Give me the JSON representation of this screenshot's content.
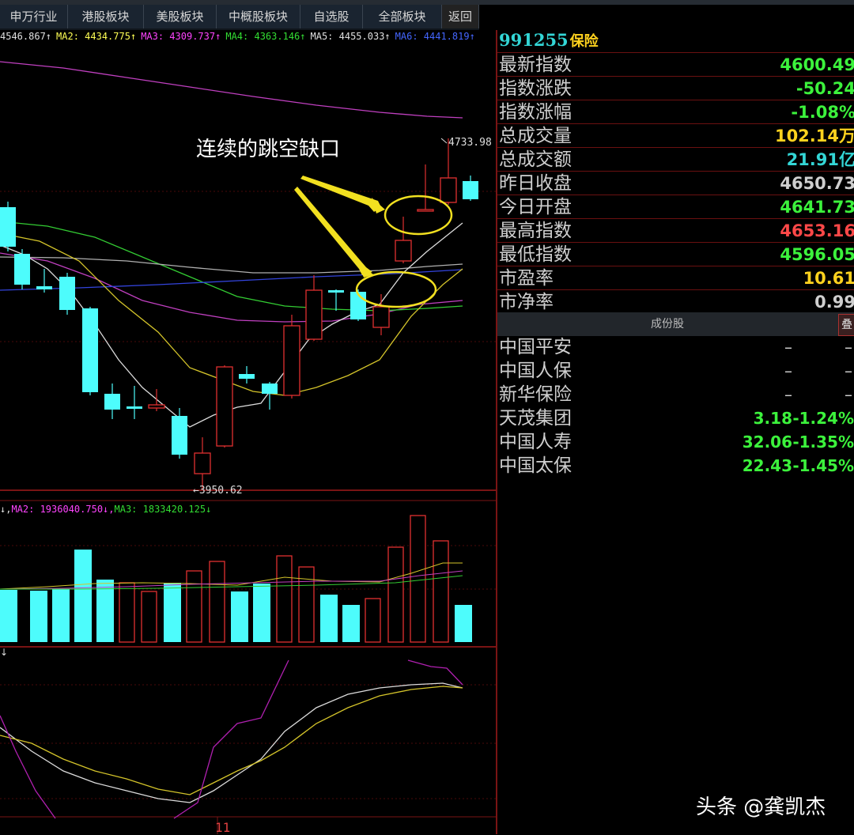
{
  "tabs": [
    "申万行业",
    "港股板块",
    "美股板块",
    "中概股板块",
    "自选股",
    "全部板块",
    "返回"
  ],
  "ma_price": [
    {
      "text": "4546.867↑",
      "color": "#e0e0e0"
    },
    {
      "text": "MA2: 4434.775↑",
      "color": "#ffff55"
    },
    {
      "text": "MA3: 4309.737↑",
      "color": "#ff44ff"
    },
    {
      "text": "MA4: 4363.146↑",
      "color": "#33dd33"
    },
    {
      "text": "MA5: 4455.033↑",
      "color": "#e0e0e0"
    },
    {
      "text": "MA6: 4441.819↑",
      "color": "#4466ff"
    }
  ],
  "annotation": "连续的跳空缺口",
  "high_label": "4733.98",
  "low_label": "←3950.62",
  "ma_volume": [
    {
      "text": "↓,",
      "color": "#e0e0e0"
    },
    {
      "text": "MA2: 1936040.750↓,",
      "color": "#ff44ff"
    },
    {
      "text": "MA3: 1833420.125↓",
      "color": "#33dd33"
    }
  ],
  "macd_mark": "↓",
  "date_label": "11",
  "panel": {
    "code": "991255",
    "name": "保险",
    "stats": [
      {
        "label": "最新指数",
        "value": "4600.49",
        "color": "#3cf23c"
      },
      {
        "label": "指数涨跌",
        "value": "-50.24",
        "color": "#3cf23c"
      },
      {
        "label": "指数涨幅",
        "value": "-1.08%",
        "color": "#3cf23c"
      },
      {
        "label": "总成交量",
        "value": "102.14万",
        "color": "#ffd21e"
      },
      {
        "label": "总成交额",
        "value": "21.91亿",
        "color": "#33d6d6"
      },
      {
        "label": "昨日收盘",
        "value": "4650.73",
        "color": "#cfcfcf"
      },
      {
        "label": "今日开盘",
        "value": "4641.73",
        "color": "#3cf23c"
      },
      {
        "label": "最高指数",
        "value": "4653.16",
        "color": "#ff4848"
      },
      {
        "label": "最低指数",
        "value": "4596.05",
        "color": "#3cf23c"
      }
    ],
    "ratios": [
      {
        "label": "市盈率",
        "value": "10.61",
        "color": "#ffd21e"
      },
      {
        "label": "市净率",
        "value": "0.99",
        "color": "#cfcfcf"
      }
    ],
    "constituents_header": "成份股",
    "overlay_button": "叠",
    "stocks": [
      {
        "name": "中国平安",
        "price": "–",
        "pct": "–"
      },
      {
        "name": "中国人保",
        "price": "–",
        "pct": "–"
      },
      {
        "name": "新华保险",
        "price": "–",
        "pct": "–"
      },
      {
        "name": "天茂集团",
        "price": "3.18",
        "pct": "-1.24%"
      },
      {
        "name": "中国人寿",
        "price": "32.06",
        "pct": "-1.35%"
      },
      {
        "name": "中国太保",
        "price": "22.43",
        "pct": "-1.45%"
      }
    ]
  },
  "watermark": "头条 @龚凯杰",
  "chart_data": {
    "type": "candlestick",
    "price_high": 4733.98,
    "price_low": 3950.62,
    "candles": [
      {
        "up": false
      },
      {
        "up": false
      },
      {
        "up": false
      },
      {
        "up": false
      },
      {
        "up": false
      },
      {
        "up": false
      },
      {
        "up": false
      },
      {
        "up": true
      },
      {
        "up": false
      },
      {
        "up": true
      },
      {
        "up": true
      },
      {
        "up": false
      },
      {
        "up": true
      },
      {
        "up": true
      },
      {
        "up": false
      },
      {
        "up": false
      },
      {
        "up": true
      },
      {
        "up": true
      },
      {
        "up": true
      },
      {
        "up": true
      },
      {
        "up": false
      }
    ]
  }
}
